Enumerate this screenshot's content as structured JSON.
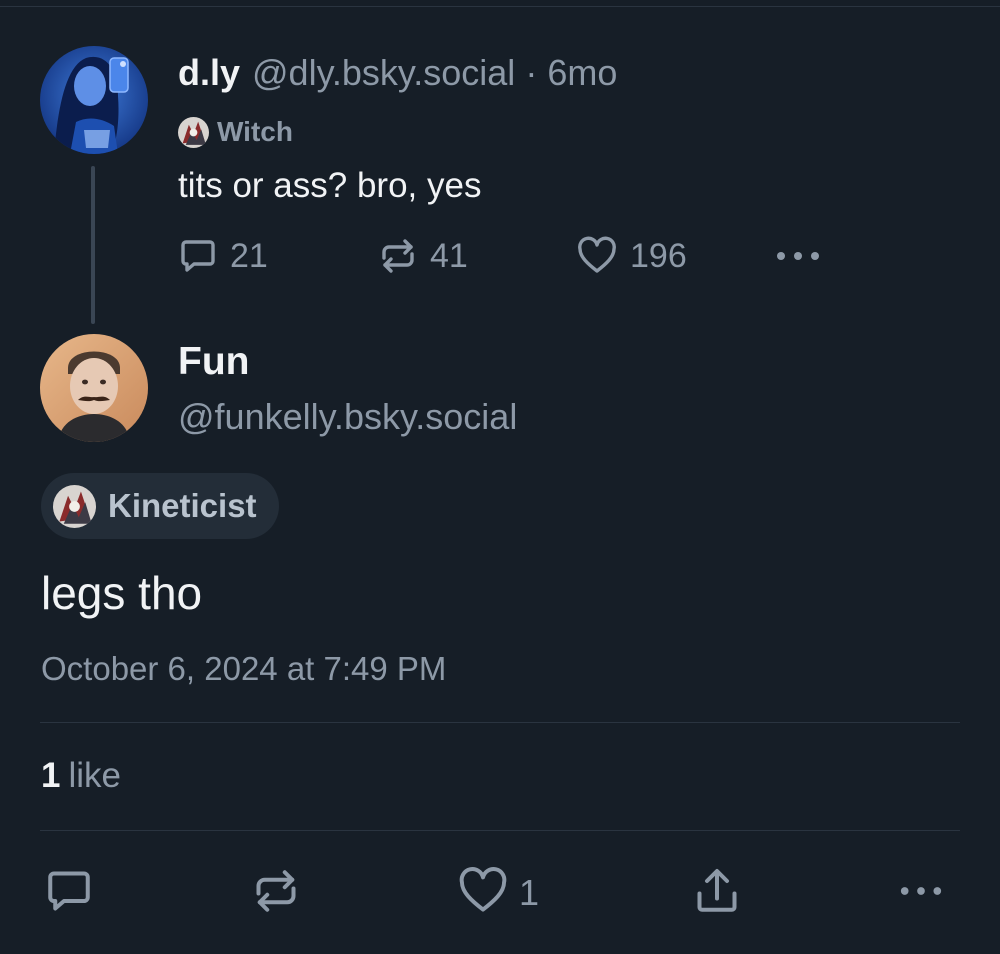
{
  "parent_post": {
    "display_name": "d.ly",
    "handle": "@dly.bsky.social",
    "separator": "·",
    "time_ago": "6mo",
    "badge_label": "Witch",
    "text": "tits or ass? bro, yes",
    "reply_count": "21",
    "repost_count": "41",
    "like_count": "196"
  },
  "main_post": {
    "display_name": "Fun",
    "handle": "@funkelly.bsky.social",
    "badge_label": "Kineticist",
    "text": "legs tho",
    "timestamp": "October 6, 2024 at 7:49 PM",
    "likes_count": "1",
    "likes_label": "like",
    "like_count": "1"
  },
  "colors": {
    "background": "#161e27",
    "text_primary": "#f1f3f5",
    "text_secondary": "#8d99a7",
    "divider": "#2a3440",
    "badge_background": "#232d38"
  },
  "icons": [
    "reply-icon",
    "repost-icon",
    "like-icon",
    "more-icon",
    "share-icon",
    "badge-icon"
  ]
}
